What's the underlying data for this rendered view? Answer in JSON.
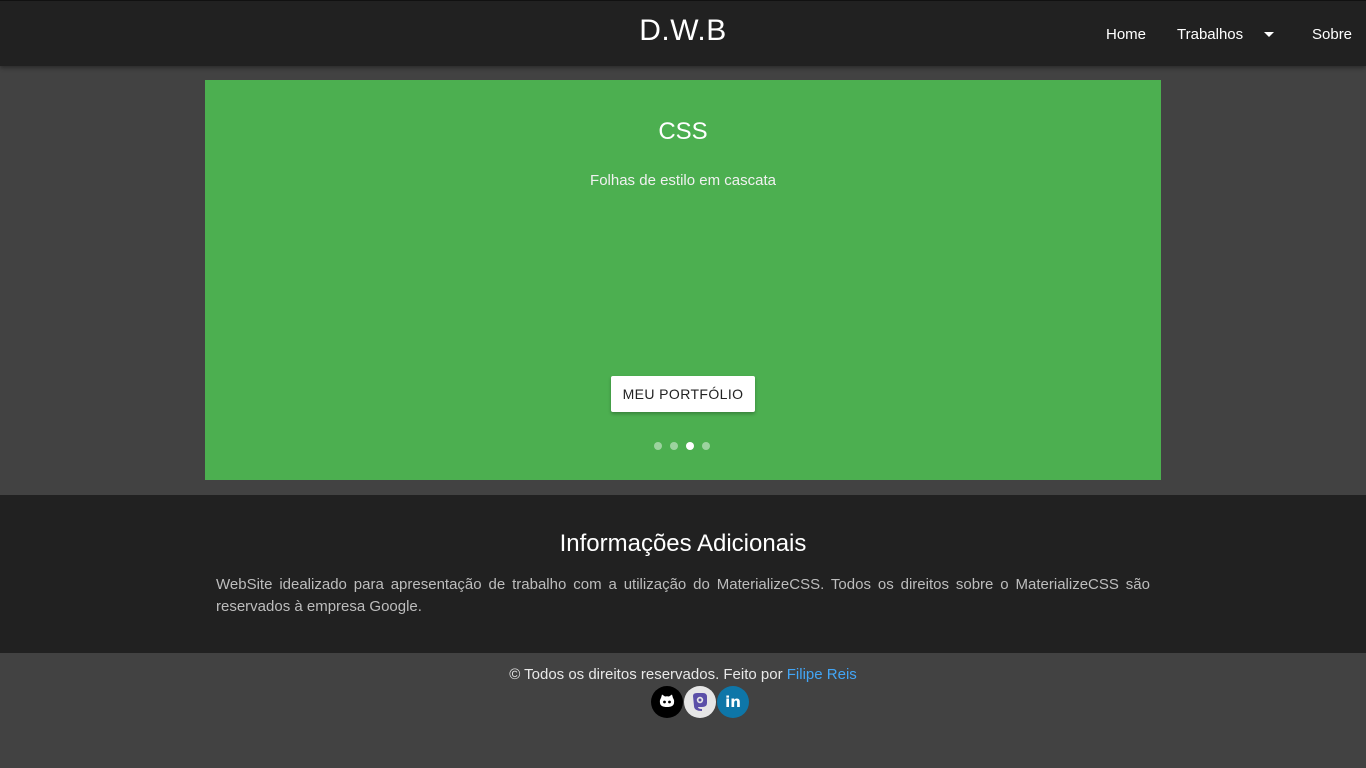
{
  "navbar": {
    "brand": "D.W.B",
    "links": {
      "home": "Home",
      "works": "Trabalhos",
      "about": "Sobre"
    }
  },
  "slider": {
    "title": "CSS",
    "subtitle": "Folhas de estilo em cascata",
    "button_label": "MEU PORTFÓLIO",
    "background_color": "#4caf50",
    "indicator_count": 4,
    "active_indicator": 3
  },
  "info": {
    "title": "Informações Adicionais",
    "text": "WebSite idealizado para apresentação de trabalho com a utilização do MaterializeCSS. Todos os direitos sobre o MaterializeCSS são reservados à empresa Google."
  },
  "footer": {
    "copyright_prefix": "© Todos os direitos reservados. Feito por ",
    "author": "Filipe Reis",
    "author_color": "#42a5f5",
    "socials": [
      {
        "icon": "github-icon",
        "color": "#000000"
      },
      {
        "icon": "mastodon-icon",
        "color": "#e6e6e6"
      },
      {
        "icon": "linkedin-icon",
        "label": "in",
        "color": "#0e76a8"
      }
    ]
  }
}
